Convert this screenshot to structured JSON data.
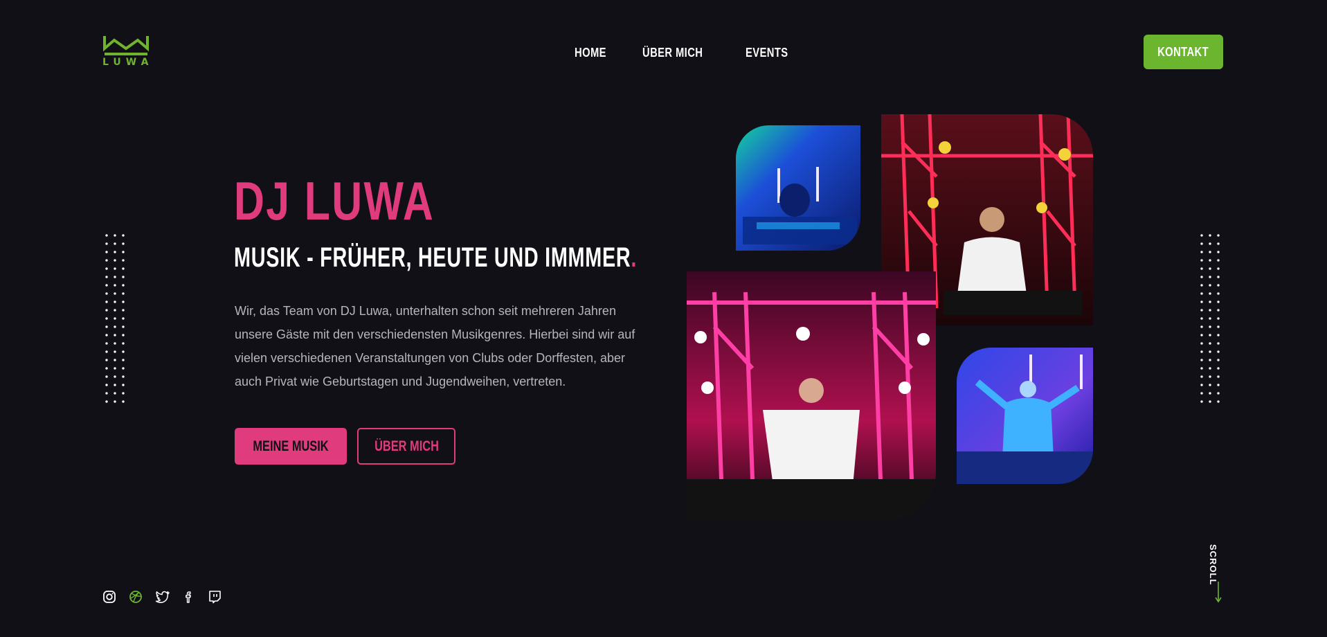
{
  "logo": {
    "text": "LUWA"
  },
  "nav": {
    "items": [
      {
        "label": "HOME"
      },
      {
        "label": "ÜBER MICH"
      },
      {
        "label": "EVENTS"
      }
    ]
  },
  "header": {
    "contact_label": "KONTAKT"
  },
  "hero": {
    "title": "DJ LUWA",
    "subtitle": "MUSIK - FRÜHER, HEUTE UND IMMMER",
    "subtitle_dot": ".",
    "text": "Wir, das Team von DJ Luwa, unterhalten schon seit mehreren Jahren unsere Gäste mit den verschiedensten Musikgenres. Hierbei sind wir auf vielen verschiedenen Veranstaltungen von Clubs oder Dorffesten, aber auch Privat wie Geburtstagen und Jugendweihen, vertreten.",
    "primary_button": "MEINE MUSIK",
    "secondary_button": "ÜBER MICH"
  },
  "social": {
    "icons": [
      "instagram-icon",
      "dribbble-icon",
      "twitter-icon",
      "facebook-icon",
      "twitch-icon"
    ]
  },
  "scroll": {
    "label": "SCROLL"
  },
  "colors": {
    "background": "#111016",
    "accent_pink": "#e03c7d",
    "accent_green": "#6bb52f"
  }
}
